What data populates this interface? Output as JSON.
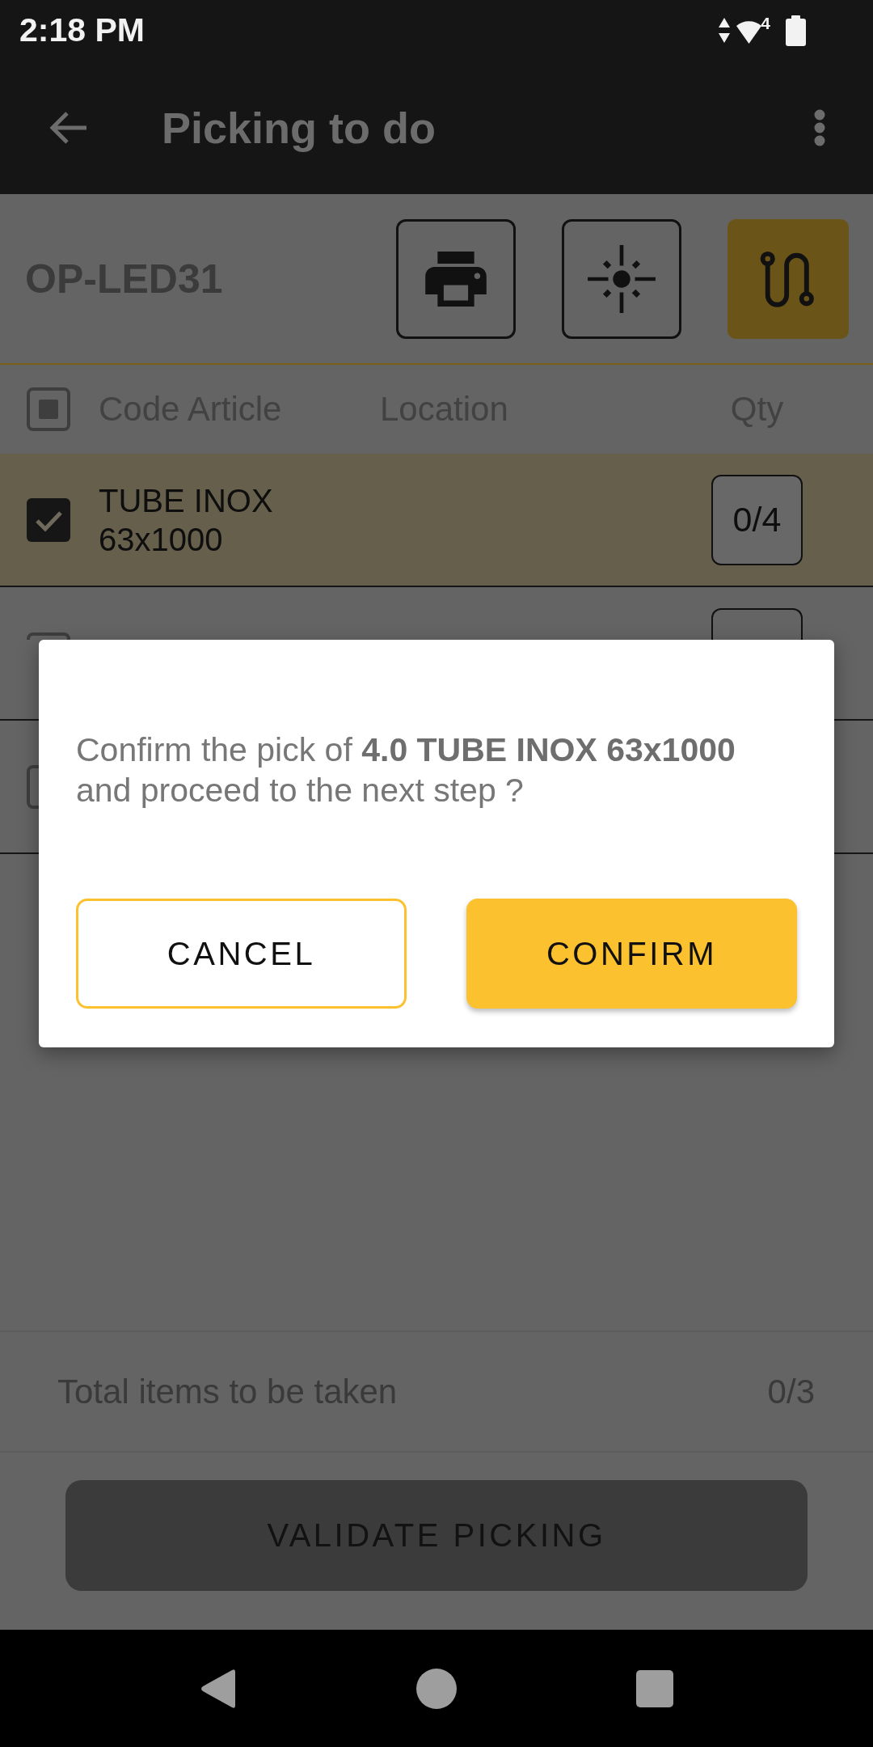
{
  "status_bar": {
    "time": "2:18 PM",
    "network_badge": "4"
  },
  "app_bar": {
    "title": "Picking to do"
  },
  "order": {
    "reference": "OP-LED31",
    "tool_buttons": [
      {
        "on": false
      },
      {
        "on": false
      },
      {
        "on": true
      }
    ]
  },
  "table": {
    "select_all": {
      "checked": false,
      "indeterminate": true
    },
    "columns": [
      "Code Article",
      "Location",
      "Qty"
    ],
    "rows": [
      {
        "selected": true,
        "checked": true,
        "code_article": "TUBE INOX 63x1000",
        "qty": "0/4"
      },
      {
        "selected": false,
        "checked": false
      },
      {
        "selected": false,
        "checked": false
      }
    ]
  },
  "dialog": {
    "message": "Confirm the pick of **4.0 TUBE INOX 63x1000** and proceed to the next step ?",
    "buttons": [
      {
        "kind": "outlined",
        "label": "CANCEL"
      },
      {
        "kind": "filled",
        "label": "CONFIRM"
      }
    ]
  },
  "summary": {
    "label": "Total items to be taken",
    "value": "0/3"
  },
  "validate_button": {
    "label": "VALIDATE PICKING"
  }
}
